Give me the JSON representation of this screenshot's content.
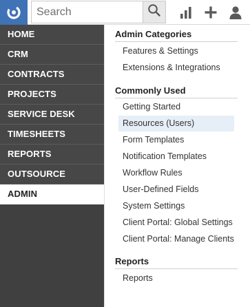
{
  "search": {
    "placeholder": "Search"
  },
  "icons": {
    "logo": "app-logo-icon",
    "search": "search-icon",
    "reports": "bar-chart-icon",
    "add": "plus-icon",
    "user": "user-icon"
  },
  "sidebar": {
    "items": [
      {
        "label": "HOME"
      },
      {
        "label": "CRM"
      },
      {
        "label": "CONTRACTS"
      },
      {
        "label": "PROJECTS"
      },
      {
        "label": "SERVICE DESK"
      },
      {
        "label": "TIMESHEETS"
      },
      {
        "label": "REPORTS"
      },
      {
        "label": "OUTSOURCE"
      },
      {
        "label": "ADMIN",
        "active": true
      }
    ]
  },
  "panel": {
    "sections": [
      {
        "title": "Admin Categories",
        "items": [
          "Features & Settings",
          "Extensions & Integrations"
        ]
      },
      {
        "title": "Commonly Used",
        "items": [
          "Getting Started",
          "Resources (Users)",
          "Form Templates",
          "Notification Templates",
          "Workflow Rules",
          "User-Defined Fields",
          "System Settings",
          "Client Portal: Global Settings",
          "Client Portal: Manage Clients"
        ],
        "highlighted": "Resources (Users)"
      },
      {
        "title": "Reports",
        "items": [
          "Reports"
        ]
      }
    ]
  },
  "colors": {
    "brand": "#3f73b6",
    "sidebar_bg": "#404040",
    "sidebar_item": "#474747",
    "highlight": "#e6eef7"
  }
}
